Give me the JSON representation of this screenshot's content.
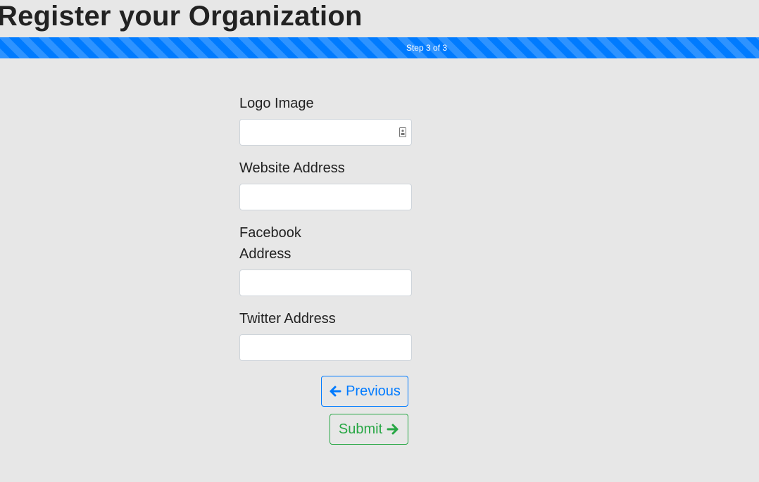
{
  "page": {
    "title": "Register your Organization"
  },
  "progress": {
    "label": "Step 3 of 3",
    "fraction": 1.0,
    "color": "#007bff"
  },
  "form": {
    "logo_image": {
      "label": "Logo Image",
      "value": "",
      "icon": "file-upload-icon"
    },
    "website_address": {
      "label": "Website Address",
      "value": ""
    },
    "facebook_address": {
      "label": "Facebook Address",
      "value": ""
    },
    "twitter_address": {
      "label": "Twitter Address",
      "value": ""
    }
  },
  "buttons": {
    "previous": {
      "label": "Previous",
      "icon": "arrow-left-icon",
      "color": "#007bff"
    },
    "submit": {
      "label": "Submit",
      "icon": "arrow-right-icon",
      "color": "#28a745"
    }
  }
}
